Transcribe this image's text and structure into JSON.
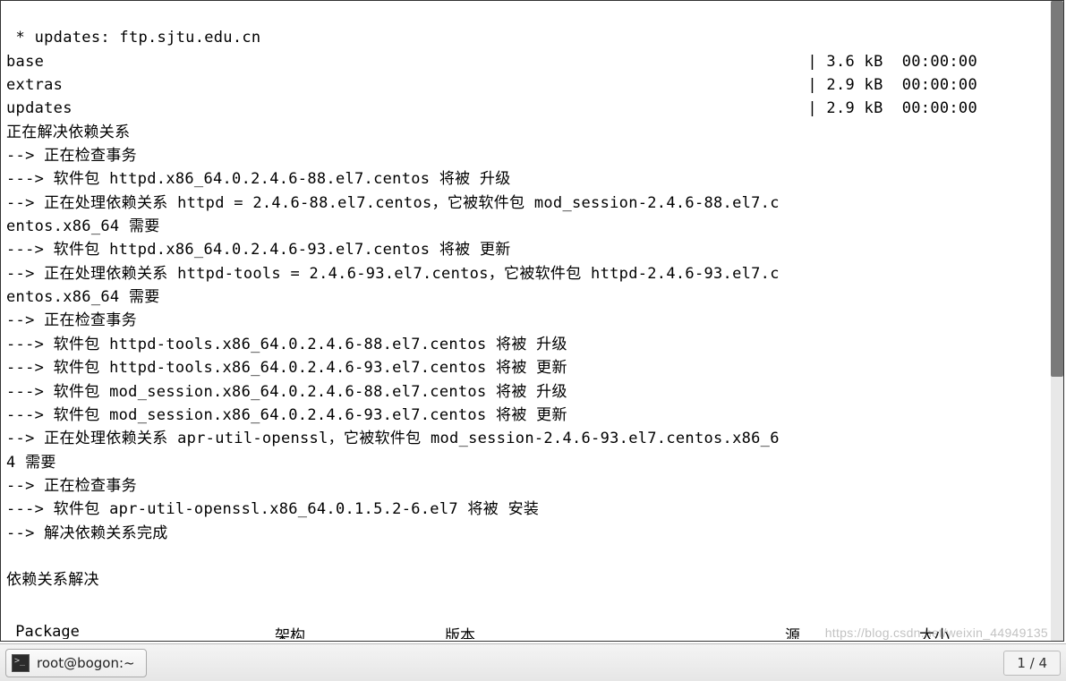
{
  "terminal": {
    "lines": {
      "l0": " * updates: ftp.sjtu.edu.cn",
      "l4": "正在解决依赖关系",
      "l5": "--> 正在检查事务",
      "l6": "---> 软件包 httpd.x86_64.0.2.4.6-88.el7.centos 将被 升级",
      "l7": "--> 正在处理依赖关系 httpd = 2.4.6-88.el7.centos，它被软件包 mod_session-2.4.6-88.el7.c",
      "l8": "entos.x86_64 需要",
      "l9": "---> 软件包 httpd.x86_64.0.2.4.6-93.el7.centos 将被 更新",
      "l10": "--> 正在处理依赖关系 httpd-tools = 2.4.6-93.el7.centos，它被软件包 httpd-2.4.6-93.el7.c",
      "l11": "entos.x86_64 需要",
      "l12": "--> 正在检查事务",
      "l13": "---> 软件包 httpd-tools.x86_64.0.2.4.6-88.el7.centos 将被 升级",
      "l14": "---> 软件包 httpd-tools.x86_64.0.2.4.6-93.el7.centos 将被 更新",
      "l15": "---> 软件包 mod_session.x86_64.0.2.4.6-88.el7.centos 将被 升级",
      "l16": "---> 软件包 mod_session.x86_64.0.2.4.6-93.el7.centos 将被 更新",
      "l17": "--> 正在处理依赖关系 apr-util-openssl，它被软件包 mod_session-2.4.6-93.el7.centos.x86_6",
      "l18": "4 需要",
      "l19": "--> 正在检查事务",
      "l20": "---> 软件包 apr-util-openssl.x86_64.0.1.5.2-6.el7 将被 安装",
      "l21": "--> 解决依赖关系完成",
      "l22": "",
      "l23": "依赖关系解决",
      "l24": ""
    },
    "repos": [
      {
        "name": "base",
        "size": "3.6 kB",
        "time": "00:00:00"
      },
      {
        "name": "extras",
        "size": "2.9 kB",
        "time": "00:00:00"
      },
      {
        "name": "updates",
        "size": "2.9 kB",
        "time": "00:00:00"
      }
    ],
    "tableHeader": {
      "c0": " Package",
      "c1": "架构",
      "c2": "版本",
      "c3": "源",
      "c4": "大小"
    }
  },
  "taskbar": {
    "title": "root@bogon:~",
    "workspace": "1 / 4"
  },
  "watermark": "https://blog.csdn.net/weixin_44949135"
}
